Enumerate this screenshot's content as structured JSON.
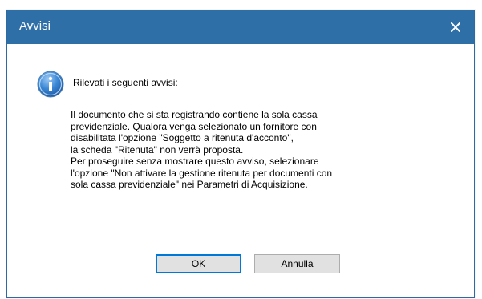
{
  "dialog": {
    "title": "Avvisi",
    "close_icon": "close-icon",
    "info_icon": "info-icon",
    "heading": "Rilevati i seguenti avvisi:",
    "message_lines": [
      "Il documento che si sta registrando contiene la sola cassa",
      "previdenziale. Qualora venga selezionato un fornitore con",
      "disabilitata l'opzione \"Soggetto a ritenuta d'acconto\",",
      "la scheda \"Ritenuta\" non verrà proposta.",
      "Per proseguire senza mostrare questo avviso, selezionare",
      "l'opzione \"Non attivare la gestione ritenuta per documenti con",
      "sola cassa previdenziale\" nei Parametri di Acquisizione."
    ],
    "buttons": {
      "ok": "OK",
      "cancel": "Annulla"
    },
    "colors": {
      "titlebar": "#2f6fa8",
      "title_text": "#ffffff",
      "button_bg": "#e1e1e1",
      "default_button_border": "#0078d7"
    }
  }
}
